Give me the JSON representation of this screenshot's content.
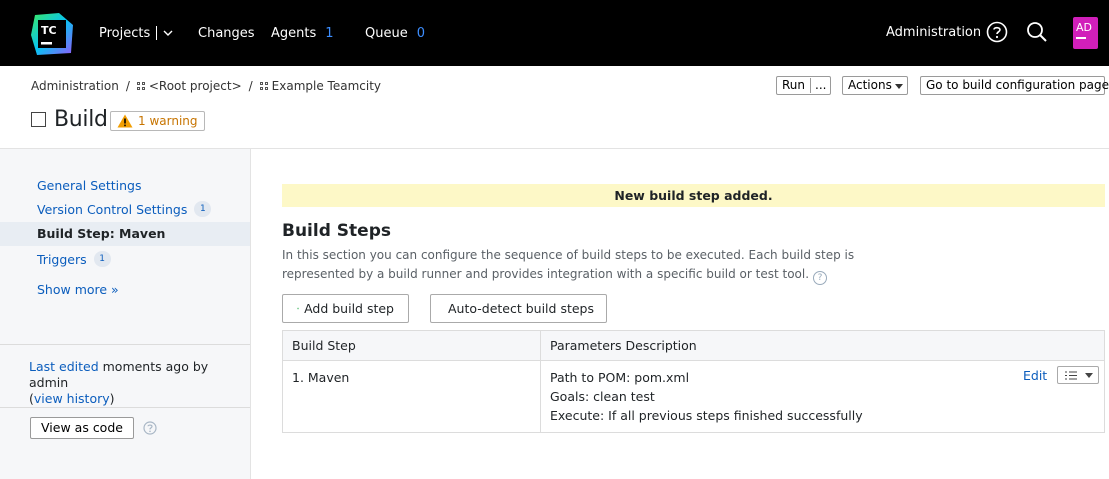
{
  "nav": {
    "projects": "Projects",
    "changes": "Changes",
    "agents": "Agents",
    "agents_count": "1",
    "queue": "Queue",
    "queue_count": "0",
    "administration": "Administration",
    "avatar_initials": "AD",
    "logo_text": "TC"
  },
  "breadcrumb": {
    "items": [
      "Administration",
      "<Root project>",
      "Example Teamcity"
    ],
    "separator": "/"
  },
  "toolbar": {
    "run": "Run",
    "run_more": "...",
    "actions": "Actions",
    "goto": "Go to build configuration page"
  },
  "page": {
    "title": "Build",
    "warning": "1 warning"
  },
  "sidebar": {
    "items": [
      {
        "label": "General Settings",
        "badge": ""
      },
      {
        "label": "Version Control Settings",
        "badge": "1"
      },
      {
        "label": "Build Step: Maven",
        "badge": ""
      },
      {
        "label": "Triggers",
        "badge": "1"
      }
    ],
    "show_more": "Show more »",
    "last_edited_link": "Last edited",
    "last_edited_text": " moments ago by admin",
    "view_history": "view history",
    "view_as_code": "View as code"
  },
  "main": {
    "notice": "New build step added.",
    "title": "Build Steps",
    "description": "In this section you can configure the sequence of build steps to be executed. Each build step is represented by a build runner and provides integration with a specific build or test tool.",
    "add_button": "Add build step",
    "auto_detect_button": "Auto-detect build steps",
    "table": {
      "headers": [
        "Build Step",
        "Parameters Description"
      ],
      "rows": [
        {
          "step": "1. Maven",
          "params": [
            "Path to POM: pom.xml",
            "Goals: clean test",
            "Execute: If all previous steps finished successfully"
          ],
          "edit": "Edit"
        }
      ]
    }
  },
  "colors": {
    "topbar": "#000000",
    "link": "#0b5dbd",
    "notice_bg": "#fdf8c7",
    "avatar": "#d11fba",
    "warning": "#c77400"
  }
}
